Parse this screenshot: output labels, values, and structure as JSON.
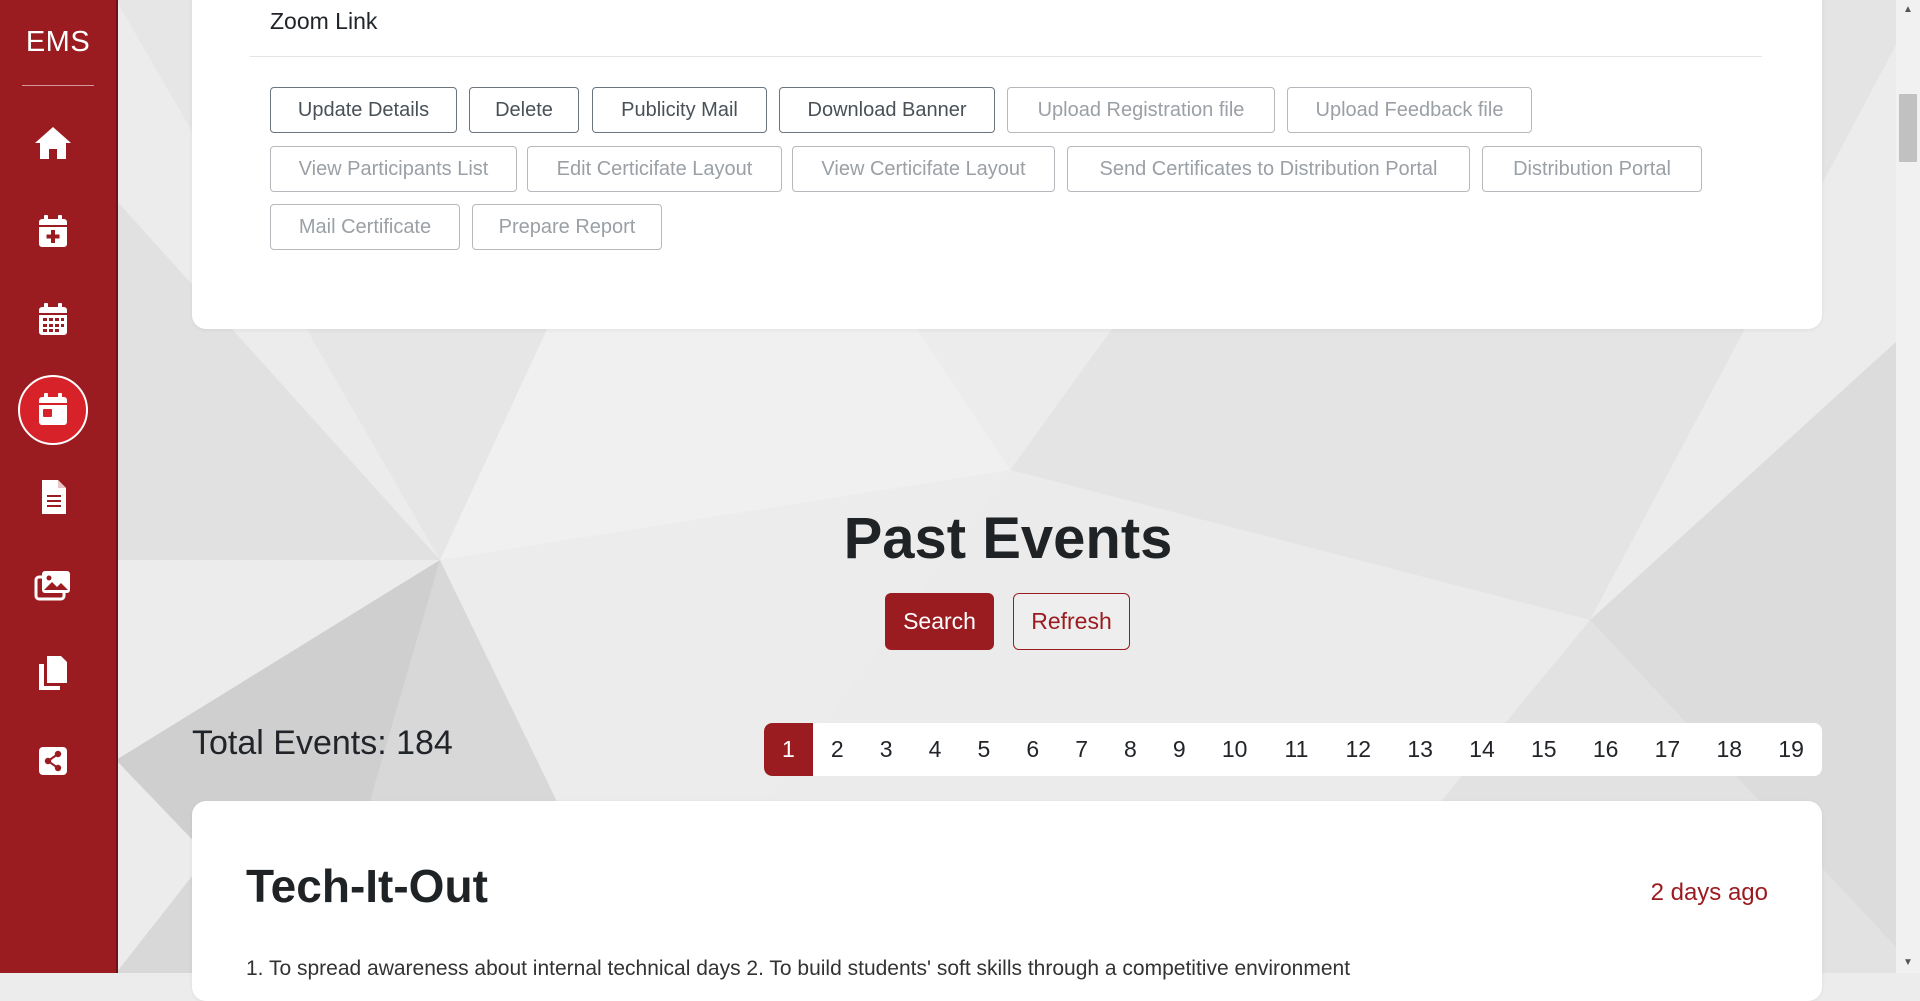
{
  "sidebar": {
    "brand": "EMS",
    "items": [
      {
        "icon": "home-icon"
      },
      {
        "icon": "calendar-plus-icon"
      },
      {
        "icon": "calendar-grid-icon"
      },
      {
        "icon": "calendar-day-icon",
        "active": true
      },
      {
        "icon": "document-icon"
      },
      {
        "icon": "images-icon"
      },
      {
        "icon": "copy-icon"
      },
      {
        "icon": "share-icon"
      }
    ]
  },
  "event_card": {
    "zoom_label": "Zoom Link",
    "buttons": {
      "update_details": "Update Details",
      "delete": "Delete",
      "publicity_mail": "Publicity Mail",
      "download_banner": "Download Banner",
      "upload_registration": "Upload Registration file",
      "upload_feedback": "Upload Feedback file",
      "view_participants": "View Participants List",
      "edit_certificate": "Edit Certicifate Layout",
      "view_certificate": "View Certicifate Layout",
      "send_certificates": "Send Certificates to Distribution Portal",
      "distribution_portal": "Distribution Portal",
      "mail_certificate": "Mail Certificate",
      "prepare_report": "Prepare Report"
    }
  },
  "past_events": {
    "title": "Past Events",
    "search_label": "Search",
    "refresh_label": "Refresh",
    "total": "Total Events: 184",
    "pages": [
      "1",
      "2",
      "3",
      "4",
      "5",
      "6",
      "7",
      "8",
      "9",
      "10",
      "11",
      "12",
      "13",
      "14",
      "15",
      "16",
      "17",
      "18",
      "19"
    ],
    "active_page": "1"
  },
  "events": [
    {
      "title": "Tech-It-Out",
      "time": "2 days ago",
      "description": "1. To spread awareness about internal technical days 2. To build students' soft skills through a competitive environment"
    }
  ],
  "colors": {
    "brand": "#9b1c20",
    "brand_active": "#d8222a"
  }
}
